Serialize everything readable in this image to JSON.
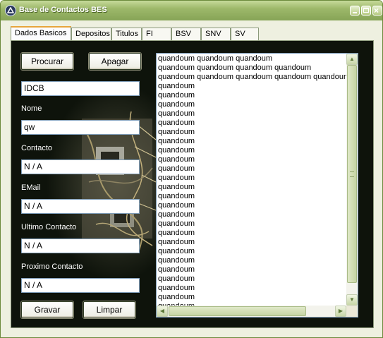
{
  "window": {
    "title": "Base de Contactos BES",
    "controls": {
      "minimize": "minimize-icon",
      "maximize": "maximize-icon",
      "close": "close-icon"
    }
  },
  "tabs": [
    {
      "label": "Dados Basicos",
      "active": true
    },
    {
      "label": "Depositos",
      "active": false
    },
    {
      "label": "Titulos",
      "active": false
    },
    {
      "label": "FI",
      "active": false
    },
    {
      "label": "BSV",
      "active": false
    },
    {
      "label": "SNV",
      "active": false
    },
    {
      "label": "SV",
      "active": false
    }
  ],
  "buttons": {
    "procurar": "Procurar",
    "apagar": "Apagar",
    "gravar": "Gravar",
    "limpar": "Limpar"
  },
  "form": {
    "idcb": {
      "value": "IDCB"
    },
    "nome": {
      "label": "Nome",
      "value": "qw"
    },
    "contacto": {
      "label": "Contacto",
      "value": "N / A"
    },
    "email": {
      "label": "EMail",
      "value": "N / A"
    },
    "ultimo_contacto": {
      "label": "Ultimo Contacto",
      "value": "N / A"
    },
    "proximo_contacto": {
      "label": "Proximo Contacto",
      "value": "N / A"
    }
  },
  "list": {
    "items": [
      "quandoum quandoum quandoum",
      "quandoum quandoum quandoum quandoum",
      "quandoum quandoum quandoum quandoum quandoum quandoum",
      "quandoum",
      "quandoum",
      "quandoum",
      "quandoum",
      "quandoum",
      "quandoum",
      "quandoum",
      "quandoum",
      "quandoum",
      "quandoum",
      "quandoum",
      "quandoum",
      "quandoum",
      "quandoum",
      "quandoum",
      "quandoum",
      "quandoum",
      "quandoum",
      "quandoum",
      "quandoum",
      "quandoum",
      "quandoum",
      "quandoum",
      "quandoum",
      "quandoum"
    ]
  },
  "colors": {
    "titlebar": "#9db86a",
    "panel_background": "#0e130b",
    "active_tab_accent": "#e7a53c"
  }
}
